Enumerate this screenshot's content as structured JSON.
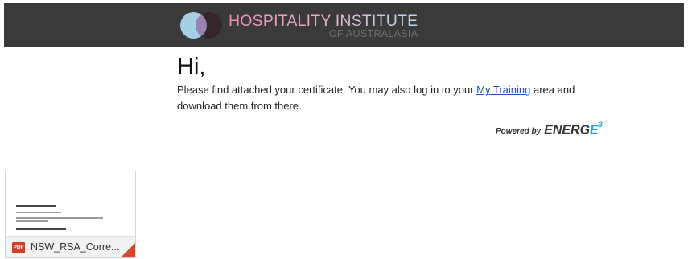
{
  "header": {
    "logo_name": "HOSPITALITY INSTITUTE",
    "logo_sub": "OF AUSTRALASIA"
  },
  "email": {
    "greeting": "Hi,",
    "message_before_link": "Please find attached your certificate. You may also log in to your ",
    "link_text": "My Training",
    "message_after_link": " area and download them from there."
  },
  "powered": {
    "label": "Powered by",
    "brand_main": "ENERG",
    "brand_e": "E",
    "brand_sup": "3"
  },
  "attachment": {
    "file_type": "PDF",
    "file_name": "NSW_RSA_Corre...",
    "badge_color": "#d93b2b"
  },
  "colors": {
    "header_bg": "#3a3a3a",
    "link": "#1f52c8",
    "accent_blue": "#2d9dd8"
  }
}
